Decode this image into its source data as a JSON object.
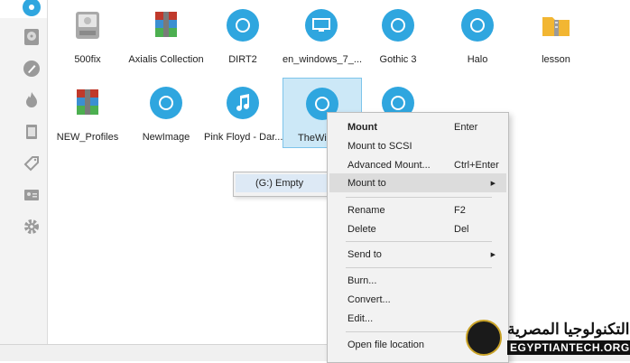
{
  "gallery": {
    "items": [
      {
        "label": "500fix",
        "icon": "hard-disk-icon"
      },
      {
        "label": "Axialis Collection",
        "icon": "archive-icon"
      },
      {
        "label": "DIRT2",
        "icon": "disc-icon"
      },
      {
        "label": "en_windows_7_...",
        "icon": "monitor-disc-icon"
      },
      {
        "label": "Gothic 3",
        "icon": "disc-icon"
      },
      {
        "label": "Halo",
        "icon": "disc-icon"
      },
      {
        "label": "lesson",
        "icon": "zip-folder-icon"
      },
      {
        "label": "NEW_Profiles",
        "icon": "archive-icon"
      },
      {
        "label": "NewImage",
        "icon": "disc-icon"
      },
      {
        "label": "Pink Floyd - Dar...",
        "icon": "music-disc-icon"
      },
      {
        "label": "TheWi",
        "icon": "disc-icon"
      }
    ]
  },
  "context_menu": {
    "mount": {
      "label": "Mount",
      "shortcut": "Enter"
    },
    "mount_scsi": {
      "label": "Mount to SCSI"
    },
    "advanced_mount": {
      "label": "Advanced Mount...",
      "shortcut": "Ctrl+Enter"
    },
    "mount_to": {
      "label": "Mount to"
    },
    "rename": {
      "label": "Rename",
      "shortcut": "F2"
    },
    "delete": {
      "label": "Delete",
      "shortcut": "Del"
    },
    "send_to": {
      "label": "Send to"
    },
    "burn": {
      "label": "Burn..."
    },
    "convert": {
      "label": "Convert..."
    },
    "edit": {
      "label": "Edit..."
    },
    "open_location": {
      "label": "Open file location"
    }
  },
  "submenu": {
    "drive": "(G:) Empty"
  },
  "watermark": {
    "arabic": "التكنولوجيا المصرية",
    "english": "EGYPTIANTECH.ORG"
  },
  "colors": {
    "accent": "#2fa6df",
    "selection": "#cce8f7"
  }
}
